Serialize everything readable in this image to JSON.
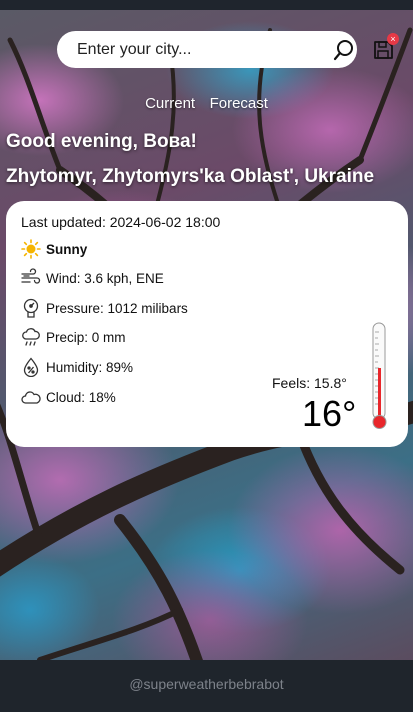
{
  "search": {
    "placeholder": "Enter your city...",
    "value": ""
  },
  "saved_badge": "×",
  "nav": {
    "current": "Current",
    "forecast": "Forecast"
  },
  "greeting": "Good evening, Вова!",
  "location": "Zhytomyr, Zhytomyrs'ka Oblast', Ukraine",
  "weather": {
    "last_updated": "Last updated: 2024-06-02 18:00",
    "condition": "Sunny",
    "wind": "Wind: 3.6 kph, ENE",
    "pressure": "Pressure: 1012 milibars",
    "precip": "Precip: 0 mm",
    "humidity": "Humidity: 89%",
    "cloud": "Cloud: 18%",
    "feels": "Feels: 15.8°",
    "temperature": "16°"
  },
  "footer": "@superweatherbebrabot",
  "colors": {
    "card_bg": "#ffffff",
    "badge": "#e63946",
    "footer_bg": "#1f252c",
    "thermo_red": "#e8262b"
  }
}
